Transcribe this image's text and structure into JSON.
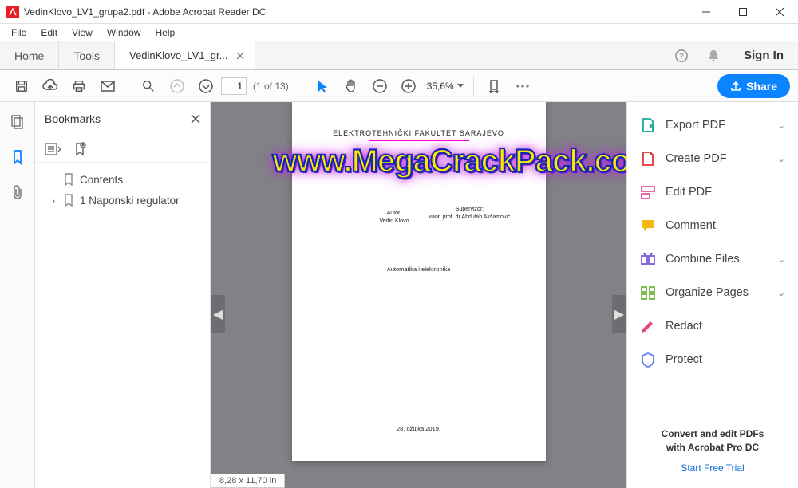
{
  "window": {
    "title": "VedinKlovo_LV1_grupa2.pdf - Adobe Acrobat Reader DC"
  },
  "menu": {
    "items": [
      "File",
      "Edit",
      "View",
      "Window",
      "Help"
    ]
  },
  "tabs": {
    "home": "Home",
    "tools": "Tools",
    "doc": "VedinKlovo_LV1_gr...",
    "signin": "Sign In"
  },
  "toolbar": {
    "page_input": "1",
    "page_count": "(1 of 13)",
    "zoom": "35,6%",
    "share": "Share"
  },
  "bookmarks": {
    "title": "Bookmarks",
    "items": [
      {
        "label": "Contents",
        "expandable": false
      },
      {
        "label": "1 Naponski regulator",
        "expandable": true
      }
    ]
  },
  "document": {
    "header": "ELEKTROTEHNIČKI FAKULTET SARAJEVO",
    "author_label": "Autor:",
    "author": "Vedin Klovo",
    "supervisor_label": "Supervizor:",
    "supervisor": "vanr. prof. dr Abdulah Akšamović",
    "subject": "Automatika i elektronika",
    "date": "28. ožujka 2019."
  },
  "watermark": "www.MegaCrackPack.com",
  "status": {
    "dims": "8,28 x 11,70 in"
  },
  "rtools": [
    {
      "name": "export-pdf",
      "label": "Export PDF",
      "color": "#1aa99b",
      "chevron": true
    },
    {
      "name": "create-pdf",
      "label": "Create PDF",
      "color": "#e0353a",
      "chevron": true
    },
    {
      "name": "edit-pdf",
      "label": "Edit PDF",
      "color": "#e85aa0",
      "chevron": false
    },
    {
      "name": "comment",
      "label": "Comment",
      "color": "#f2b80f",
      "chevron": false
    },
    {
      "name": "combine-files",
      "label": "Combine Files",
      "color": "#7a5cd6",
      "chevron": true
    },
    {
      "name": "organize-pages",
      "label": "Organize Pages",
      "color": "#6fb53c",
      "chevron": true
    },
    {
      "name": "redact",
      "label": "Redact",
      "color": "#e4457e",
      "chevron": false
    },
    {
      "name": "protect",
      "label": "Protect",
      "color": "#6b7cf5",
      "chevron": false
    }
  ],
  "promo": {
    "line1": "Convert and edit PDFs",
    "line2": "with Acrobat Pro DC",
    "cta": "Start Free Trial"
  }
}
